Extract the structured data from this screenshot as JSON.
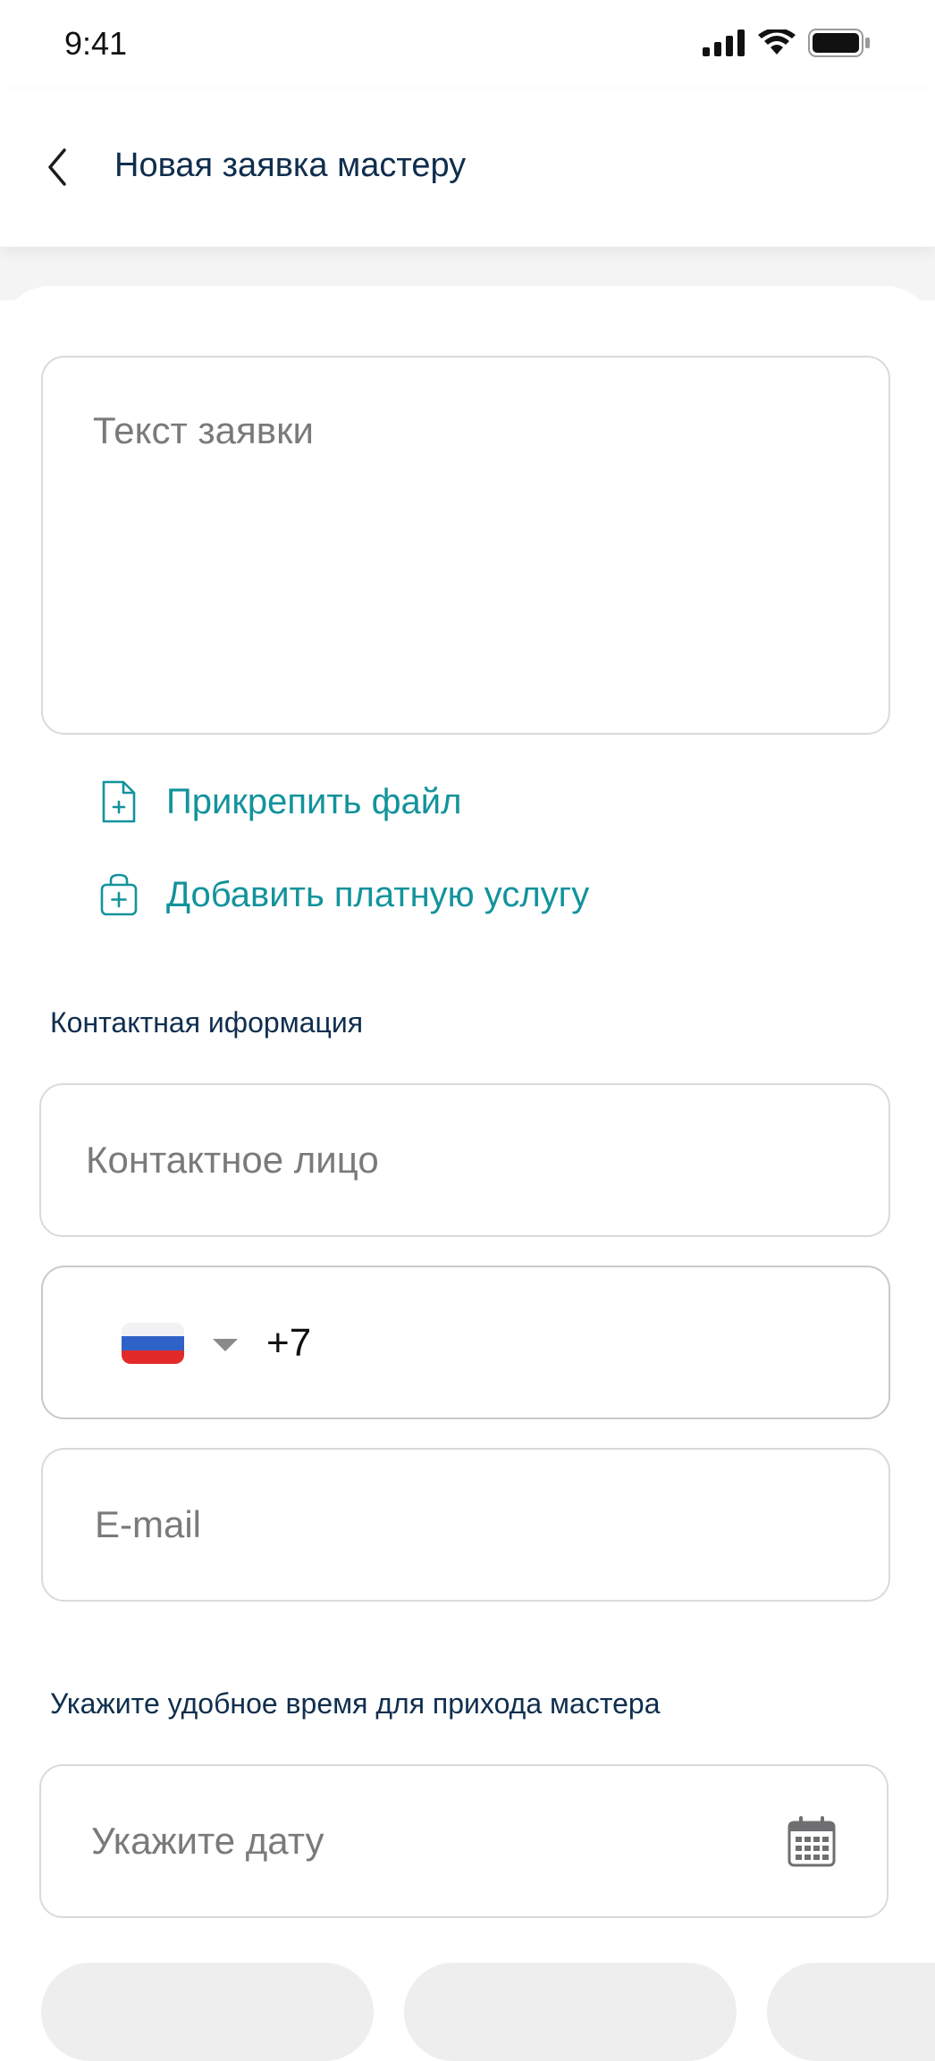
{
  "status_bar": {
    "time": "9:41"
  },
  "header": {
    "title": "Новая заявка мастеру"
  },
  "request": {
    "placeholder": "Текст заявки"
  },
  "actions": {
    "attach_file": "Прикрепить файл",
    "add_paid_service": "Добавить платную услугу"
  },
  "contact": {
    "section_title": "Контактная иформация",
    "name_placeholder": "Контактное лицо",
    "phone_country_code": "+7",
    "email_placeholder": "E-mail"
  },
  "schedule": {
    "section_title": "Укажите удобное время для прихода мастера",
    "date_placeholder": "Укажите дату"
  },
  "colors": {
    "accent": "#13939c",
    "title": "#0f2e4e",
    "border": "#d9dadd",
    "flag_white": "#f2f2f4",
    "flag_blue": "#2f62c8",
    "flag_red": "#e32a2a"
  },
  "icons": [
    "signal-icon",
    "wifi-icon",
    "battery-icon",
    "back-chevron-icon",
    "file-plus-icon",
    "bag-plus-icon",
    "russia-flag-icon",
    "dropdown-caret-icon",
    "calendar-icon"
  ]
}
